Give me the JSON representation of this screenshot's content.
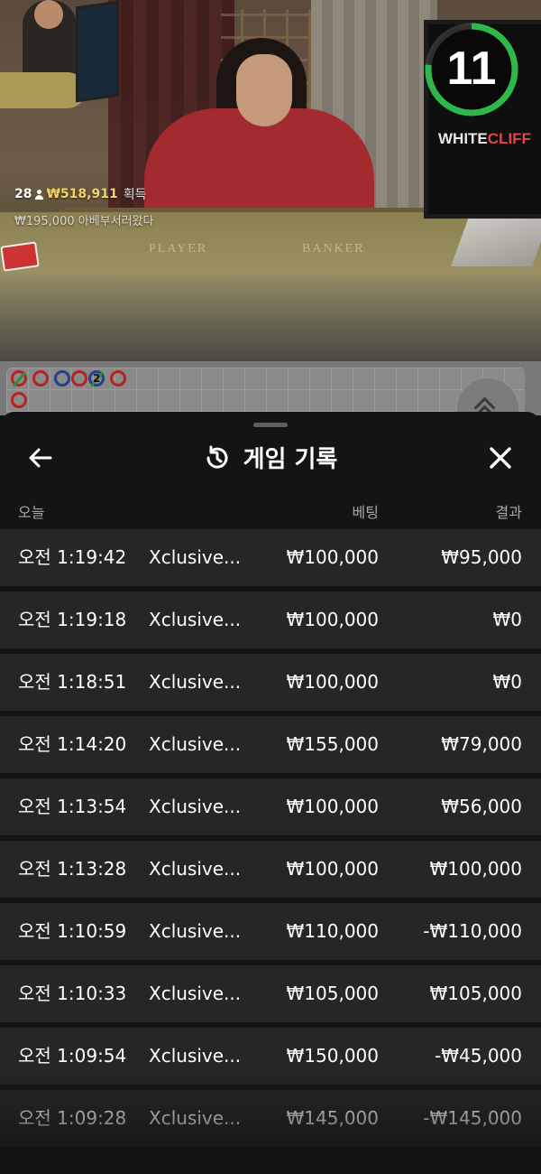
{
  "video": {
    "timer": "11",
    "brand_white": "WHITE",
    "brand_red": "CLIFF",
    "table_left_label": "PLAYER",
    "table_right_label": "BANKER",
    "winner_count": "28",
    "win_amount": "₩518,911",
    "win_suffix": "획득",
    "bet_notice": "₩195,000 아베부서러왔다"
  },
  "roadmap": {
    "beads": [
      {
        "color": "red",
        "tie": true,
        "num": ""
      },
      {
        "color": "red",
        "tie": false,
        "num": ""
      },
      {
        "color": "blue",
        "tie": false,
        "num": ""
      },
      {
        "color": "red",
        "tie": false,
        "num": ""
      },
      {
        "color": "blue",
        "tie": true,
        "num": "2"
      },
      {
        "color": "red",
        "tie": false,
        "num": ""
      },
      {
        "color": "red",
        "tie": false,
        "num": ""
      }
    ],
    "collapse_icon": "chevron-double-up-icon"
  },
  "sheet": {
    "title": "게임 기록",
    "title_icon": "history-icon",
    "back_icon": "arrow-left-icon",
    "close_icon": "close-icon",
    "columns": {
      "date": "오늘",
      "bet": "베팅",
      "result": "결과"
    },
    "rows": [
      {
        "time": "오전 1:19:42",
        "game": "Xclusive...",
        "bet": "₩100,000",
        "result": "₩95,000"
      },
      {
        "time": "오전 1:19:18",
        "game": "Xclusive...",
        "bet": "₩100,000",
        "result": "₩0"
      },
      {
        "time": "오전 1:18:51",
        "game": "Xclusive...",
        "bet": "₩100,000",
        "result": "₩0"
      },
      {
        "time": "오전 1:14:20",
        "game": "Xclusive...",
        "bet": "₩155,000",
        "result": "₩79,000"
      },
      {
        "time": "오전 1:13:54",
        "game": "Xclusive...",
        "bet": "₩100,000",
        "result": "₩56,000"
      },
      {
        "time": "오전 1:13:28",
        "game": "Xclusive...",
        "bet": "₩100,000",
        "result": "₩100,000"
      },
      {
        "time": "오전 1:10:59",
        "game": "Xclusive...",
        "bet": "₩110,000",
        "result": "-₩110,000"
      },
      {
        "time": "오전 1:10:33",
        "game": "Xclusive...",
        "bet": "₩105,000",
        "result": "₩105,000"
      },
      {
        "time": "오전 1:09:54",
        "game": "Xclusive...",
        "bet": "₩150,000",
        "result": "-₩45,000"
      },
      {
        "time": "오전 1:09:28",
        "game": "Xclusive...",
        "bet": "₩145,000",
        "result": "-₩145,000"
      }
    ]
  },
  "colors": {
    "sheet_bg": "#141414",
    "row_bg": "#262626",
    "timer_ring": "#2fb84a",
    "win_amount": "#f2d46a",
    "bead_red": "#b52222",
    "bead_blue": "#23408a"
  }
}
